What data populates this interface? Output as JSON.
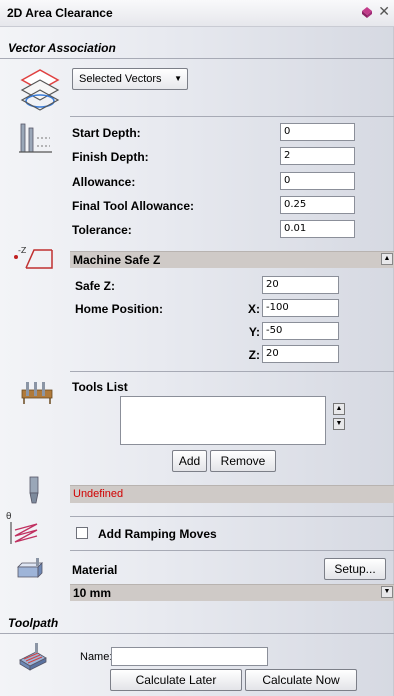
{
  "window": {
    "title": "2D Area Clearance"
  },
  "vector_association": {
    "heading": "Vector Association",
    "dropdown_value": "Selected Vectors"
  },
  "depths": {
    "start_depth": {
      "label": "Start Depth:",
      "value": "0"
    },
    "finish_depth": {
      "label": "Finish Depth:",
      "value": "2"
    },
    "allowance": {
      "label": "Allowance:",
      "value": "0"
    },
    "final_tool_allowance": {
      "label": "Final Tool Allowance:",
      "value": "0.25"
    },
    "tolerance": {
      "label": "Tolerance:",
      "value": "0.01"
    }
  },
  "machine_safe_z": {
    "heading": "Machine Safe Z",
    "safe_z": {
      "label": "Safe Z:",
      "value": "20"
    },
    "home_position": {
      "label": "Home Position:",
      "x": {
        "label": "X:",
        "value": "-100"
      },
      "y": {
        "label": "Y:",
        "value": "-50"
      },
      "z": {
        "label": "Z:",
        "value": "20"
      }
    }
  },
  "tools_list": {
    "heading": "Tools List",
    "add_label": "Add",
    "remove_label": "Remove"
  },
  "tool_status": {
    "text": "Undefined",
    "color": "#d00000"
  },
  "ramping": {
    "label": "Add Ramping Moves",
    "checked": false
  },
  "material": {
    "heading": "Material",
    "setup_label": "Setup...",
    "thickness": "10 mm"
  },
  "toolpath": {
    "heading": "Toolpath",
    "name_label": "Name:",
    "name_value": "",
    "calculate_later_label": "Calculate Later",
    "calculate_now_label": "Calculate Now"
  },
  "colors": {
    "bar_background": "#cfcac7",
    "accent_red": "#d00000"
  }
}
